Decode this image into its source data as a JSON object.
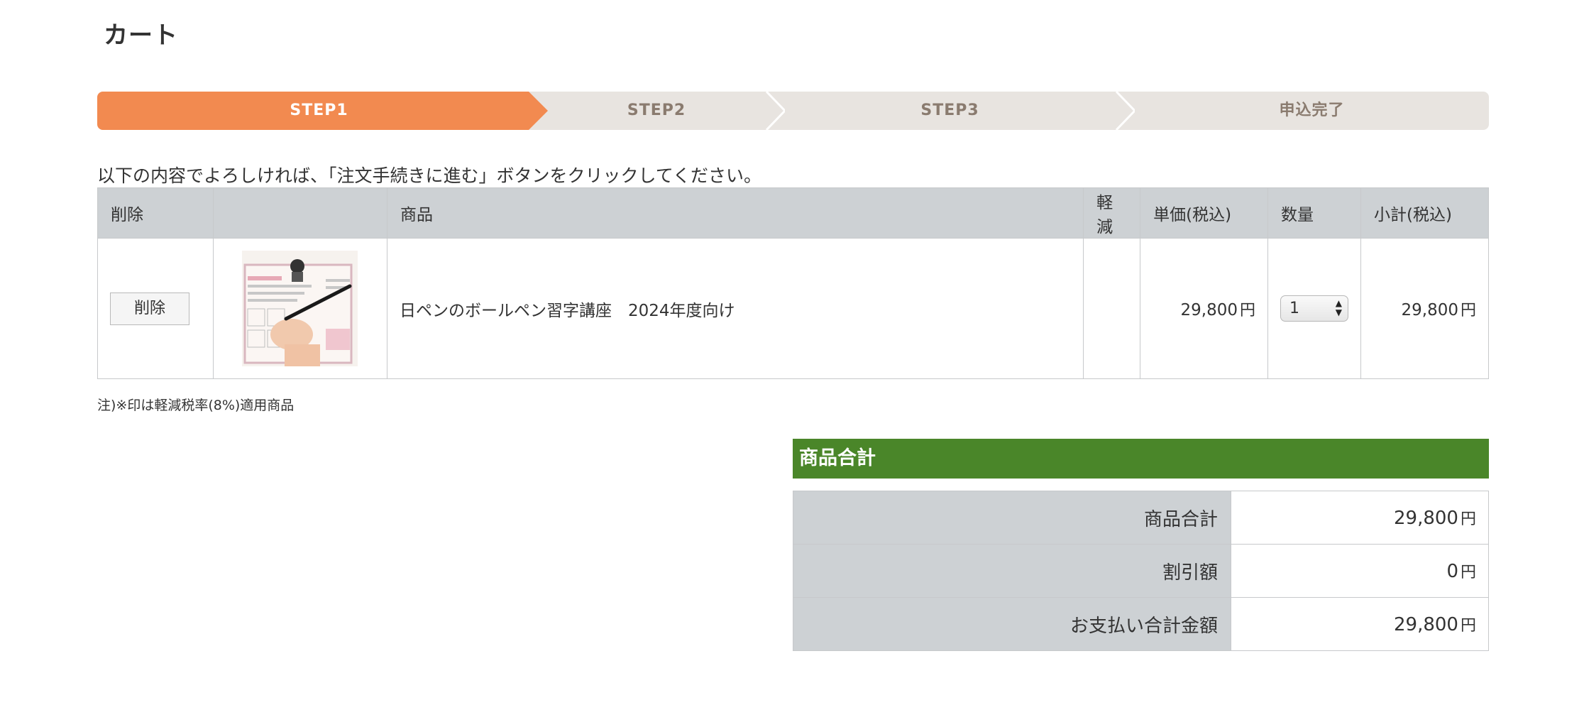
{
  "page_title": "カート",
  "steps": [
    {
      "label": "STEP1",
      "active": true
    },
    {
      "label": "STEP2",
      "active": false
    },
    {
      "label": "STEP3",
      "active": false
    },
    {
      "label": "申込完了",
      "active": false
    }
  ],
  "instruction": "以下の内容でよろしければ、「注文手続きに進む」ボタンをクリックしてください。",
  "cart": {
    "headers": {
      "delete": "削除",
      "image": "",
      "product": "商品",
      "reduced": "軽減",
      "unit_price": "単価(税込)",
      "quantity": "数量",
      "subtotal": "小計(税込)"
    },
    "items": [
      {
        "delete_label": "削除",
        "product_name": "日ペンのボールペン習字講座　2024年度向け",
        "reduced": "",
        "unit_price": "29,800",
        "quantity": "1",
        "subtotal": "29,800"
      }
    ],
    "currency": "円"
  },
  "note": "注)※印は軽減税率(8%)適用商品",
  "summary": {
    "title": "商品合計",
    "rows": [
      {
        "label": "商品合計",
        "value": "29,800"
      },
      {
        "label": "割引額",
        "value": "0"
      },
      {
        "label": "お支払い合計金額",
        "value": "29,800"
      }
    ],
    "currency": "円"
  },
  "colors": {
    "step_active": "#f28a50",
    "step_inactive": "#e8e4e0",
    "summary_header": "#4a8629",
    "table_header": "#cdd1d4"
  }
}
